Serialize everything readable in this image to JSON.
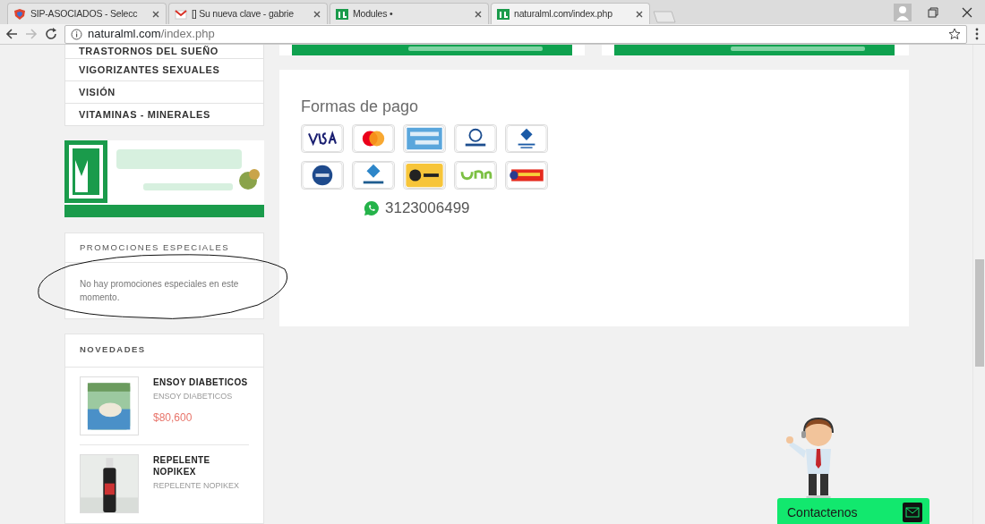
{
  "browser": {
    "tabs": [
      {
        "title": "SIP-ASOCIADOS - Selecc",
        "kind": "shield",
        "selected": false
      },
      {
        "title": "[] Su nueva clave - gabrie",
        "kind": "mail",
        "selected": false
      },
      {
        "title": "Modules •",
        "kind": "site",
        "selected": false
      },
      {
        "title": "naturalml.com/index.php",
        "kind": "site",
        "selected": true
      }
    ],
    "url_host": "naturalml.com",
    "url_path": "/index.php"
  },
  "sidebar": {
    "categories": [
      "TRASTORNOS DEL SUEÑO",
      "VIGORIZANTES SEXUALES",
      "VISIÓN",
      "VITAMINAS - MINERALES"
    ],
    "promotions": {
      "title": "PROMOCIONES ESPECIALES",
      "message": "No hay promociones especiales en este momento."
    },
    "news": {
      "title": "NOVEDADES",
      "products": [
        {
          "name": "ENSOY DIABETICOS",
          "subtitle": "ENSOY DIABETICOS",
          "price": "$80,600",
          "kind": "can"
        },
        {
          "name": "REPELENTE NOPIKEX",
          "subtitle": "REPELENTE NOPIKEX",
          "kind": "bottle"
        }
      ]
    }
  },
  "payment": {
    "title": "Formas de pago",
    "methods": [
      {
        "kind": "visa"
      },
      {
        "kind": "mastercard"
      },
      {
        "kind": "amex"
      },
      {
        "kind": "diners"
      },
      {
        "kind": "bank"
      },
      {
        "kind": "pse"
      },
      {
        "kind": "safetypay"
      },
      {
        "kind": "efecty"
      },
      {
        "kind": "gana"
      },
      {
        "kind": "baloto"
      }
    ],
    "phone": "3123006499"
  },
  "contact": {
    "label": "Contactenos"
  }
}
